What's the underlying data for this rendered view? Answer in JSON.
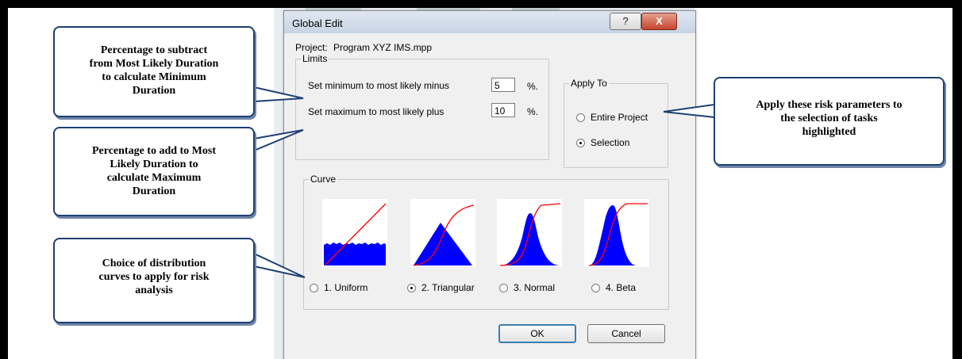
{
  "dialog": {
    "title": "Global Edit",
    "help_symbol": "?",
    "close_symbol": "X",
    "project_label": "Project:",
    "project_name": "Program XYZ IMS.mpp",
    "limits": {
      "title": "Limits",
      "min_label": "Set minimum to most likely minus",
      "min_value": "5",
      "max_label": "Set maximum to most likely plus",
      "max_value": "10",
      "unit": "%."
    },
    "apply_to": {
      "title": "Apply To",
      "options": [
        {
          "label": "Entire Project",
          "selected": false
        },
        {
          "label": "Selection",
          "selected": true
        }
      ]
    },
    "curve": {
      "title": "Curve",
      "options": [
        {
          "label": "1. Uniform",
          "selected": false
        },
        {
          "label": "2. Triangular",
          "selected": true
        },
        {
          "label": "3. Normal",
          "selected": false
        },
        {
          "label": "4. Beta",
          "selected": false
        }
      ]
    },
    "ok_label": "OK",
    "cancel_label": "Cancel"
  },
  "callouts": {
    "min": [
      "Percentage to subtract",
      "from Most Likely Duration",
      "to calculate Minimum",
      "Duration"
    ],
    "max": [
      "Percentage to add to Most",
      "Likely Duration to",
      "calculate Maximum",
      "Duration"
    ],
    "curves": [
      "Choice of distribution",
      "curves to apply for risk",
      "analysis"
    ],
    "apply": [
      "Apply these risk parameters to",
      "the selection of tasks",
      "highlighted"
    ]
  },
  "colors": {
    "distribution_fill": "#0000ff",
    "cumulative_line": "#ff0000",
    "callout_border": "#1f3f74"
  },
  "icons": {
    "help": "help-icon",
    "close": "close-icon"
  }
}
